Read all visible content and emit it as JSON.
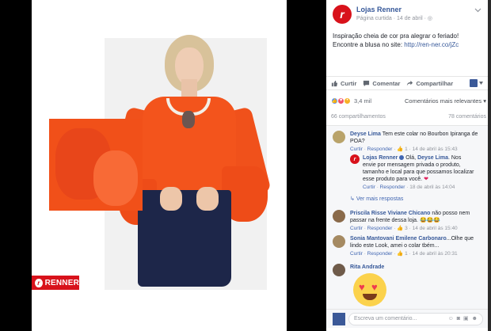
{
  "photo": {
    "brand_badge": "RENNER",
    "brand_mark": "r"
  },
  "post": {
    "page_avatar_letter": "r",
    "page_name": "Lojas Renner",
    "meta": "Página curtida · 14 de abril · ◎",
    "text_line1": "Inspiração cheia de cor pra alegrar o feriado!",
    "text_line2": "Encontre a blusa no site:",
    "link": "http://ren-ner.co/jZc"
  },
  "actions": {
    "like": "Curtir",
    "comment": "Comentar",
    "share": "Compartilhar"
  },
  "reactions": {
    "count": "3,4 mil",
    "sort": "Comentários mais relevantes ▾"
  },
  "stats": {
    "shares": "66 compartilhamentos",
    "comments": "78 comentários"
  },
  "comments": [
    {
      "author": "Deyse Lima",
      "text": "Tem este colar no Bourbon Ipiranga de POA?",
      "like": "Curtir",
      "reply": "Responder",
      "likes": "1",
      "date": "14 de abril às 15:43"
    },
    {
      "author": "Priscila Risse",
      "mention": "Viviane Chicano",
      "text": "não posso nem passar na frente dessa loja. 😂😂😂",
      "like": "Curtir",
      "reply": "Responder",
      "likes": "3",
      "date": "14 de abril às 15:40"
    },
    {
      "author": "Sonia Mantovani",
      "mention": "Emilene Carbonaro",
      "text": "...Olhe que lindo este Look, amei o colar tbém...",
      "like": "Curtir",
      "reply": "Responder",
      "likes": "1",
      "date": "14 de abril às 20:31"
    },
    {
      "author": "Rita Andrade"
    }
  ],
  "reply": {
    "author": "Lojas Renner",
    "mention": "Deyse Lima",
    "text_before": "Olá,",
    "text_after": ". Nos envie por mensagem privada o produto, tamanho e local para que possamos localizar esse produto para você.",
    "like": "Curtir",
    "reply": "Responder",
    "date": "18 de abril às 14:04",
    "see_more": "Ver mais respostas"
  },
  "composer": {
    "placeholder": "Escreva um comentário..."
  }
}
